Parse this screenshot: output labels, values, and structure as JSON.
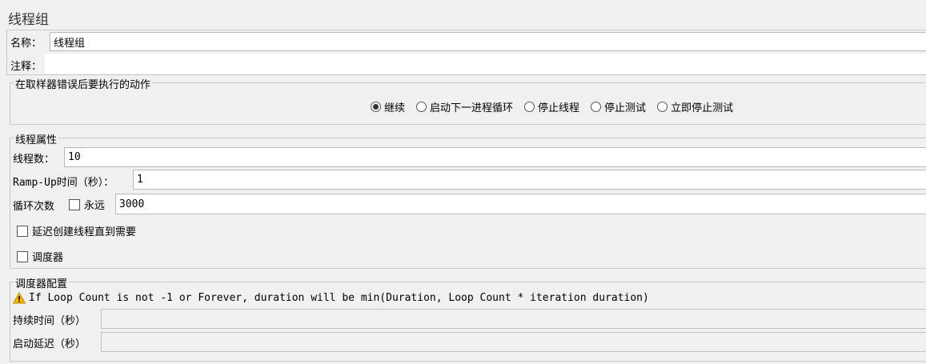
{
  "page_title": "线程组",
  "name_label": "名称：",
  "name_value": "线程组",
  "comment_label": "注释：",
  "comment_value": "",
  "sampler_error": {
    "legend": "在取样器错误后要执行的动作",
    "options": [
      "继续",
      "启动下一进程循环",
      "停止线程",
      "停止测试",
      "立即停止测试"
    ],
    "selected_index": 0
  },
  "thread_props": {
    "legend": "线程属性",
    "threads_label": "线程数：",
    "threads_value": "10",
    "rampup_label": "Ramp-Up时间（秒）：",
    "rampup_value": "1",
    "loop_label": "循环次数",
    "forever_label": "永远",
    "forever_checked": false,
    "loop_value": "3000",
    "delay_label": "延迟创建线程直到需要",
    "delay_checked": false,
    "scheduler_label": "调度器",
    "scheduler_checked": false
  },
  "scheduler_config": {
    "legend": "调度器配置",
    "warning_icon": "warning-triangle-icon",
    "warning_text": "If Loop Count is not -1 or Forever, duration will be min(Duration, Loop Count * iteration duration)",
    "duration_label": "持续时间（秒）",
    "duration_value": "",
    "startup_delay_label": "启动延迟（秒）",
    "startup_delay_value": ""
  },
  "colors": {
    "background": "#f0f0f0",
    "field_border": "#b8b8b8",
    "warning": "#f5b800"
  }
}
